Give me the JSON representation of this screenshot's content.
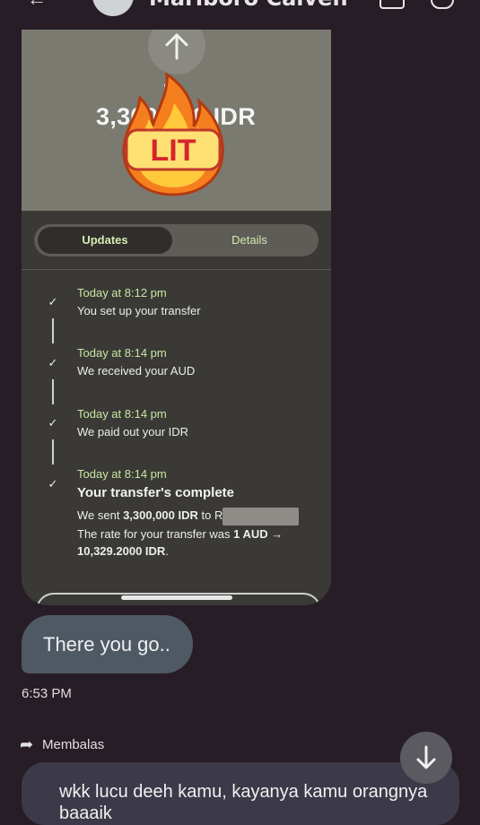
{
  "header": {
    "contact_name": "Marlboro Calven",
    "back_icon": "arrow-left-icon"
  },
  "screenshot": {
    "amount_caption": "S",
    "amount": "3,300,000 IDR",
    "sticker_text": "LIT",
    "tabs": [
      {
        "label": "Updates",
        "active": true
      },
      {
        "label": "Details",
        "active": false
      }
    ],
    "timeline": [
      {
        "time": "Today at 8:12 pm",
        "text": "You set up your transfer"
      },
      {
        "time": "Today at 8:14 pm",
        "text": "We received your AUD"
      },
      {
        "time": "Today at 8:14 pm",
        "text": "We paid out your IDR"
      },
      {
        "time": "Today at 8:14 pm",
        "text": "Your transfer's complete"
      }
    ],
    "detail_sent_prefix": "We sent ",
    "detail_sent_amount": "3,300,000 IDR",
    "detail_sent_to": " to R",
    "detail_rate_prefix": "The rate for your transfer was ",
    "detail_rate_value": "1 AUD →",
    "detail_rate_value2": "10,329.2000 IDR",
    "detail_rate_suffix": "."
  },
  "messages": {
    "outgoing_text": "There you go..",
    "outgoing_time": "6:53 PM",
    "reply_label": "Membalas",
    "incoming_line1": "wkk lucu deeh kamu, kayanya kamu orangnya",
    "incoming_line2": "baaaik"
  },
  "colors": {
    "background": "#271d27",
    "accent_green": "#c9e6a4",
    "outgoing_bubble": "#4f5964"
  }
}
